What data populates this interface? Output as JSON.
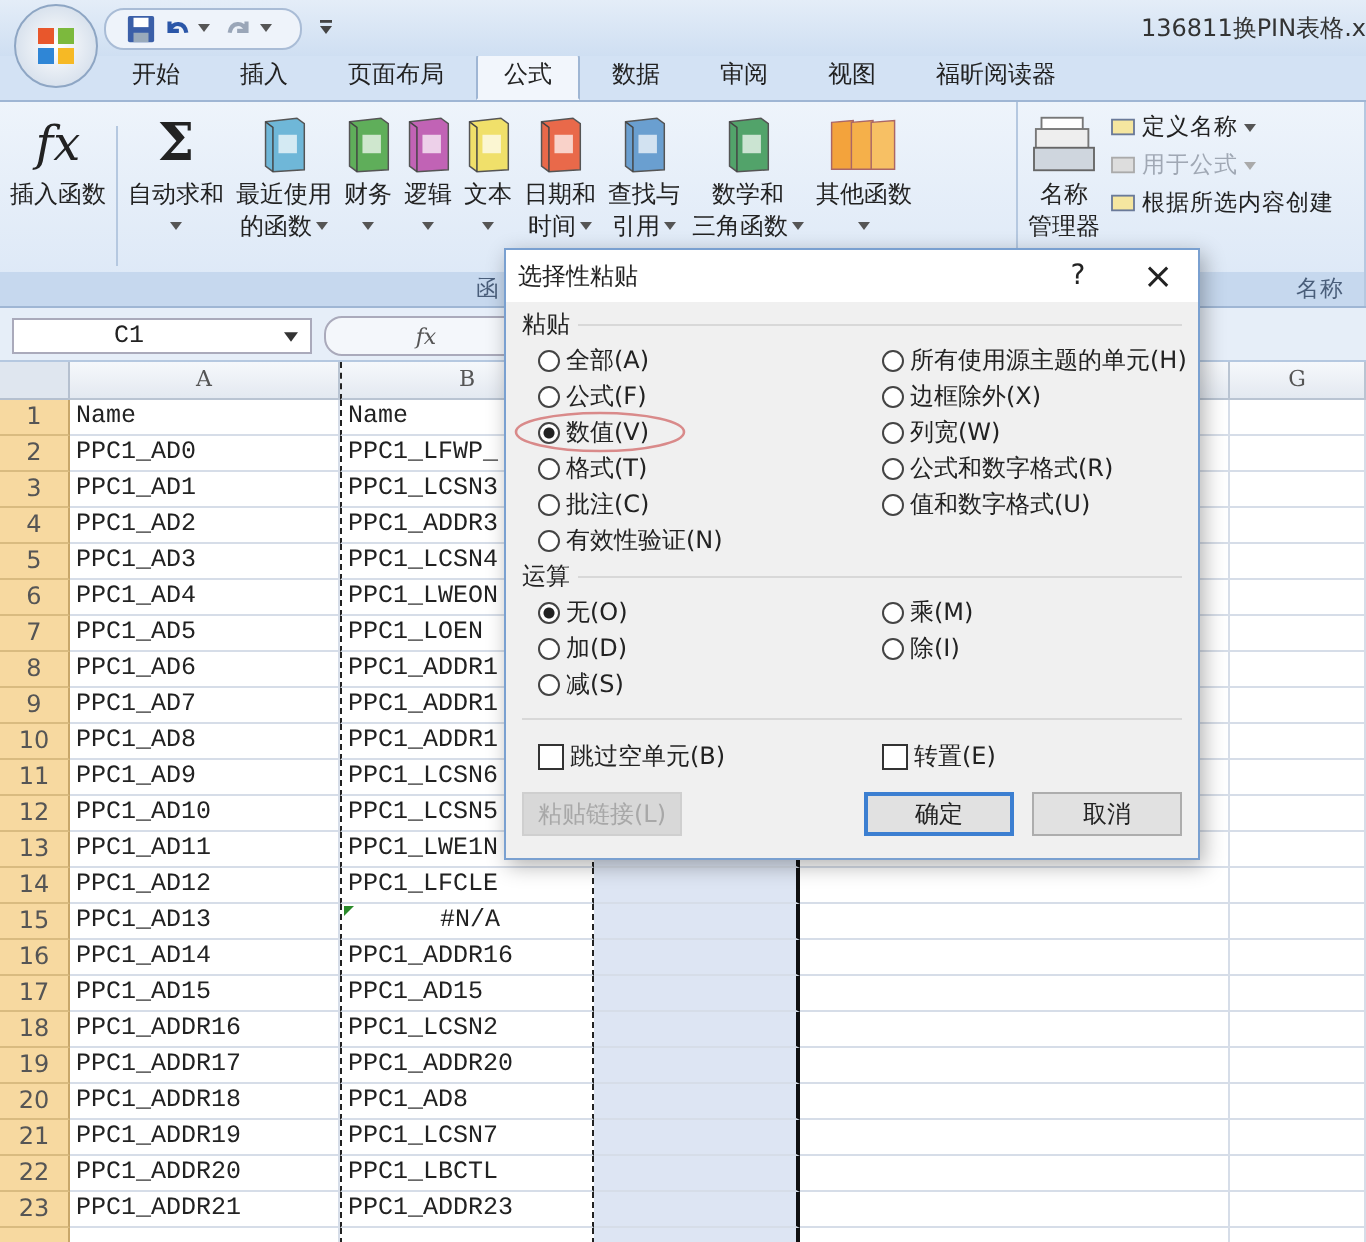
{
  "title_bar": {
    "document_title": "136811换PIN表格.x"
  },
  "tabs": [
    {
      "label": "开始",
      "selected": false
    },
    {
      "label": "插入",
      "selected": false
    },
    {
      "label": "页面布局",
      "selected": false
    },
    {
      "label": "公式",
      "selected": true
    },
    {
      "label": "数据",
      "selected": false
    },
    {
      "label": "审阅",
      "selected": false
    },
    {
      "label": "视图",
      "selected": false
    },
    {
      "label": "福昕阅读器",
      "selected": false
    }
  ],
  "ribbon": {
    "function_buttons": [
      {
        "kind": "glyph",
        "glyph": "fx",
        "lines": [
          "插入函数"
        ],
        "dropdown": false
      },
      {
        "kind": "glyph",
        "glyph": "Σ",
        "lines": [
          "自动求和"
        ],
        "dropdown": true
      },
      {
        "kind": "book",
        "lines": [
          "最近使用",
          "的函数"
        ],
        "dropdown": true
      },
      {
        "kind": "book",
        "lines": [
          "财务"
        ],
        "dropdown": true
      },
      {
        "kind": "book",
        "lines": [
          "逻辑"
        ],
        "dropdown": true
      },
      {
        "kind": "book",
        "lines": [
          "文本"
        ],
        "dropdown": true
      },
      {
        "kind": "book",
        "lines": [
          "日期和",
          "时间"
        ],
        "dropdown": true
      },
      {
        "kind": "book",
        "lines": [
          "查找与",
          "引用"
        ],
        "dropdown": true
      },
      {
        "kind": "book",
        "lines": [
          "数学和",
          "三角函数"
        ],
        "dropdown": true
      },
      {
        "kind": "books",
        "lines": [
          "其他函数"
        ],
        "dropdown": true
      }
    ],
    "function_group_label": "函",
    "name_manager": {
      "lines": [
        "名称",
        "管理器"
      ]
    },
    "name_items": [
      {
        "label": "定义名称",
        "dropdown": true,
        "disabled": false
      },
      {
        "label": "用于公式",
        "dropdown": true,
        "disabled": true
      },
      {
        "label": "根据所选内容创建",
        "dropdown": false,
        "disabled": false
      }
    ],
    "name_group_label": "名称"
  },
  "formula_bar": {
    "name_box": "C1",
    "function_glyph": "fx"
  },
  "sheet": {
    "columns": [
      {
        "label": "A",
        "selected": false,
        "copied": false
      },
      {
        "label": "B",
        "selected": false,
        "copied": true
      },
      {
        "selected": true,
        "copied": false
      },
      {
        "selected": false,
        "copied": false
      },
      {
        "label": "G",
        "selected": false,
        "copied": false
      }
    ],
    "rows": [
      {
        "number": "1",
        "a": "Name",
        "b": "Name",
        "b_error": false
      },
      {
        "number": "2",
        "a": "PPC1_AD0",
        "b": "PPC1_LFWP_",
        "b_error": false
      },
      {
        "number": "3",
        "a": "PPC1_AD1",
        "b": "PPC1_LCSN3",
        "b_error": false
      },
      {
        "number": "4",
        "a": "PPC1_AD2",
        "b": "PPC1_ADDR3",
        "b_error": false
      },
      {
        "number": "5",
        "a": "PPC1_AD3",
        "b": "PPC1_LCSN4",
        "b_error": false
      },
      {
        "number": "6",
        "a": "PPC1_AD4",
        "b": "PPC1_LWEON",
        "b_error": false
      },
      {
        "number": "7",
        "a": "PPC1_AD5",
        "b": "PPC1_LOEN",
        "b_error": false
      },
      {
        "number": "8",
        "a": "PPC1_AD6",
        "b": "PPC1_ADDR1",
        "b_error": false
      },
      {
        "number": "9",
        "a": "PPC1_AD7",
        "b": "PPC1_ADDR1",
        "b_error": false
      },
      {
        "number": "10",
        "a": "PPC1_AD8",
        "b": "PPC1_ADDR1",
        "b_error": false
      },
      {
        "number": "11",
        "a": "PPC1_AD9",
        "b": "PPC1_LCSN6",
        "b_error": false
      },
      {
        "number": "12",
        "a": "PPC1_AD10",
        "b": "PPC1_LCSN5",
        "b_error": false
      },
      {
        "number": "13",
        "a": "PPC1_AD11",
        "b": "PPC1_LWE1N",
        "b_error": false
      },
      {
        "number": "14",
        "a": "PPC1_AD12",
        "b": "PPC1_LFCLE",
        "b_error": false
      },
      {
        "number": "15",
        "a": "PPC1_AD13",
        "b": "#N/A",
        "b_error": true
      },
      {
        "number": "16",
        "a": "PPC1_AD14",
        "b": "PPC1_ADDR16",
        "b_error": false
      },
      {
        "number": "17",
        "a": "PPC1_AD15",
        "b": "PPC1_AD15",
        "b_error": false
      },
      {
        "number": "18",
        "a": "PPC1_ADDR16",
        "b": "PPC1_LCSN2",
        "b_error": false
      },
      {
        "number": "19",
        "a": "PPC1_ADDR17",
        "b": "PPC1_ADDR20",
        "b_error": false
      },
      {
        "number": "20",
        "a": "PPC1_ADDR18",
        "b": "PPC1_AD8",
        "b_error": false
      },
      {
        "number": "21",
        "a": "PPC1_ADDR19",
        "b": "PPC1_LCSN7",
        "b_error": false
      },
      {
        "number": "22",
        "a": "PPC1_ADDR20",
        "b": "PPC1_LBCTL",
        "b_error": false
      },
      {
        "number": "23",
        "a": "PPC1_ADDR21",
        "b": "PPC1_ADDR23",
        "b_error": false
      }
    ]
  },
  "dialog": {
    "title": "选择性粘贴",
    "help": "?",
    "close": "×",
    "paste_label": "粘贴",
    "paste_options": [
      {
        "label": "全部(A)",
        "selected": false,
        "highlighted": false
      },
      {
        "label": "公式(F)",
        "selected": false,
        "highlighted": false
      },
      {
        "label": "数值(V)",
        "selected": true,
        "highlighted": true
      },
      {
        "label": "格式(T)",
        "selected": false,
        "highlighted": false
      },
      {
        "label": "批注(C)",
        "selected": false,
        "highlighted": false
      },
      {
        "label": "有效性验证(N)",
        "selected": false,
        "highlighted": false
      },
      {
        "label": "所有使用源主题的单元(H)",
        "selected": false,
        "highlighted": false
      },
      {
        "label": "边框除外(X)",
        "selected": false,
        "highlighted": false
      },
      {
        "label": "列宽(W)",
        "selected": false,
        "highlighted": false
      },
      {
        "label": "公式和数字格式(R)",
        "selected": false,
        "highlighted": false
      },
      {
        "label": "值和数字格式(U)",
        "selected": false,
        "highlighted": false
      }
    ],
    "operation_label": "运算",
    "operation_options": [
      {
        "label": "无(O)",
        "selected": true
      },
      {
        "label": "加(D)",
        "selected": false
      },
      {
        "label": "减(S)",
        "selected": false
      },
      {
        "label": "乘(M)",
        "selected": false
      },
      {
        "label": "除(I)",
        "selected": false
      }
    ],
    "checkboxes": [
      {
        "label": "跳过空单元(B)",
        "checked": false
      },
      {
        "label": "转置(E)",
        "checked": false
      }
    ],
    "buttons": [
      {
        "label": "粘贴链接(L)",
        "disabled": true,
        "default": false
      },
      {
        "label": "确定",
        "disabled": false,
        "default": true
      },
      {
        "label": "取消",
        "disabled": false,
        "default": false
      }
    ]
  }
}
